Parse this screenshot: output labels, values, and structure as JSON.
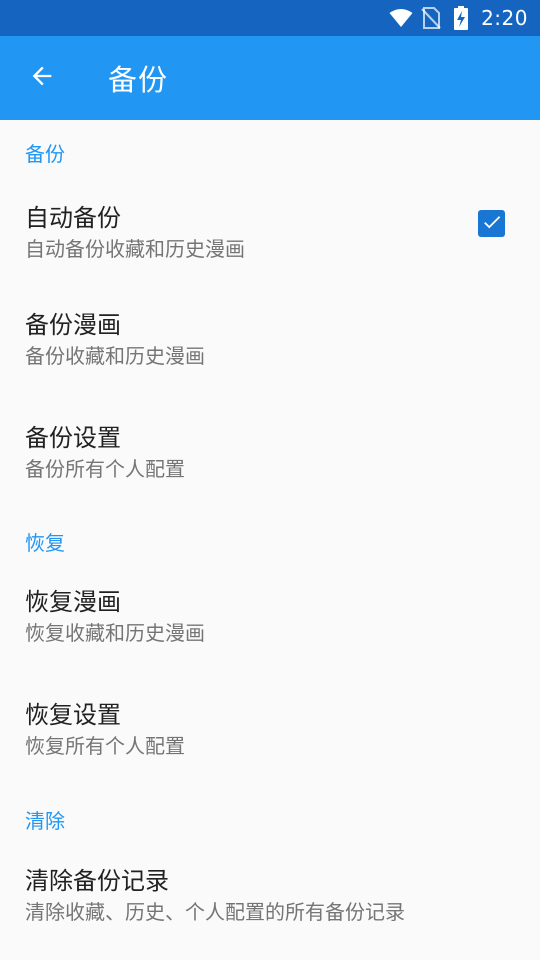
{
  "status_bar": {
    "time": "2:20",
    "icons": [
      "wifi-icon",
      "no-sim-icon",
      "battery-charging-icon"
    ]
  },
  "app_bar": {
    "back_icon": "arrow-left-icon",
    "title": "备份"
  },
  "colors": {
    "status_bar": "#1565c0",
    "app_bar": "#2196f3",
    "category_text": "#2196f3",
    "checkbox": "#1976d2"
  },
  "sections": {
    "backup": {
      "header": "备份",
      "auto_backup": {
        "title": "自动备份",
        "summary": "自动备份收藏和历史漫画",
        "checked": true
      },
      "backup_comics": {
        "title": "备份漫画",
        "summary": "备份收藏和历史漫画"
      },
      "backup_settings": {
        "title": "备份设置",
        "summary": "备份所有个人配置"
      }
    },
    "restore": {
      "header": "恢复",
      "restore_comics": {
        "title": "恢复漫画",
        "summary": "恢复收藏和历史漫画"
      },
      "restore_settings": {
        "title": "恢复设置",
        "summary": "恢复所有个人配置"
      }
    },
    "clear": {
      "header": "清除",
      "clear_records": {
        "title": "清除备份记录",
        "summary": "清除收藏、历史、个人配置的所有备份记录"
      }
    }
  }
}
